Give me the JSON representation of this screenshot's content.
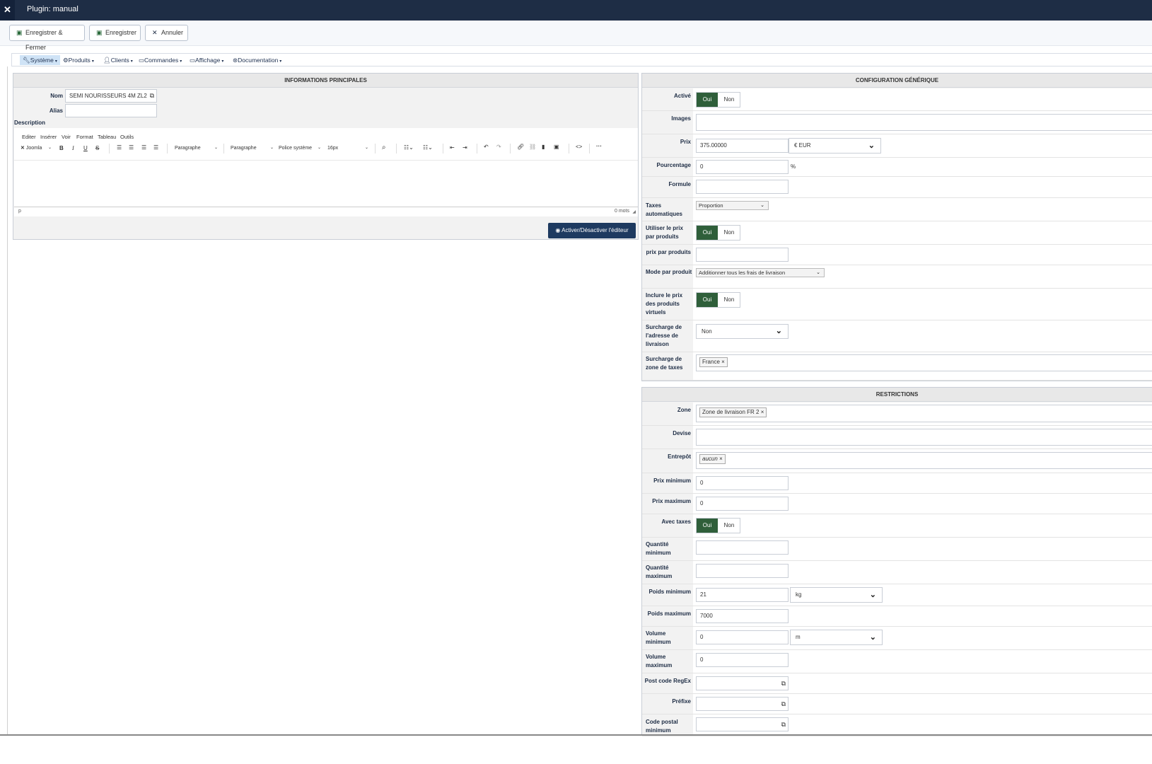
{
  "app": {
    "title": "Plugin: manual",
    "logo_glyph": "✕"
  },
  "toolbar": {
    "save_close": "Enregistrer & Fermer",
    "save": "Enregistrer",
    "cancel": "Annuler"
  },
  "menu": {
    "items": [
      {
        "label": "Système"
      },
      {
        "label": "Produits"
      },
      {
        "label": "Clients"
      },
      {
        "label": "Commandes"
      },
      {
        "label": "Affichage"
      },
      {
        "label": "Documentation"
      }
    ]
  },
  "main_info": {
    "header": "INFORMATIONS PRINCIPALES",
    "nom_label": "Nom",
    "nom_value": "SEMI NOURISSEURS 4M ZL2",
    "alias_label": "Alias",
    "alias_value": "",
    "description_label": "Description",
    "editor": {
      "menu": [
        "Editer",
        "Insérer",
        "Voir",
        "Format",
        "Tableau",
        "Outils"
      ],
      "joomla": "Joomla",
      "block1": "Paragraphe",
      "block2": "Paragraphe",
      "font": "Police système",
      "size": "16px",
      "status_path": "p",
      "word_count": "0 mots",
      "toggle_button": "Activer/Désactiver l'éditeur"
    }
  },
  "generic_config": {
    "header": "CONFIGURATION GÉNÉRIQUE",
    "yes": "Oui",
    "no": "Non",
    "active_label": "Activé",
    "images_label": "Images",
    "price_label": "Prix",
    "price_value": "375.00000",
    "currency": "€ EUR",
    "percentage_label": "Pourcentage",
    "percentage_value": "0",
    "percent_sign": "%",
    "formula_label": "Formule",
    "auto_taxes_label": "Taxes automatiques",
    "auto_taxes_value": "Proportion",
    "use_product_price_label": "Utiliser le prix par produits",
    "price_per_product_label": "prix par produits",
    "mode_per_product_label": "Mode par produit",
    "mode_per_product_value": "Additionner tous les frais de livraison",
    "include_virtual_label": "Inclure le prix des produits virtuels",
    "override_address_label": "Surcharge de l'adresse de livraison",
    "override_address_value": "Non",
    "override_tax_zone_label": "Surcharge de zone de taxes",
    "override_tax_zone_tag": "France"
  },
  "restrictions": {
    "header": "RESTRICTIONS",
    "zone_label": "Zone",
    "zone_tag": "Zone de livraison FR 2",
    "currency_label": "Devise",
    "warehouse_label": "Entrepôt",
    "warehouse_tag": "aucun",
    "min_price_label": "Prix minimum",
    "min_price_value": "0",
    "max_price_label": "Prix maximum",
    "max_price_value": "0",
    "with_taxes_label": "Avec taxes",
    "min_qty_label": "Quantité minimum",
    "max_qty_label": "Quantité maximum",
    "min_weight_label": "Poids minimum",
    "min_weight_value": "21",
    "weight_unit": "kg",
    "max_weight_label": "Poids maximum",
    "max_weight_value": "7000",
    "min_volume_label": "Volume minimum",
    "min_volume_value": "0",
    "volume_unit": "m",
    "max_volume_label": "Volume maximum",
    "max_volume_value": "0",
    "postcode_regex_label": "Post code RegEx",
    "prefix_label": "Préfixe",
    "postcode_min_label": "Code postal minimum"
  }
}
